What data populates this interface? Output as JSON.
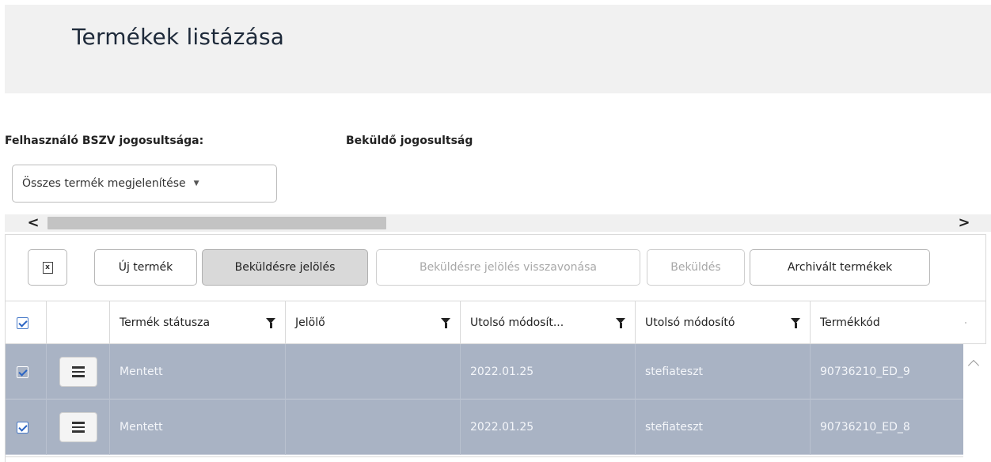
{
  "page": {
    "title": "Termékek listázása"
  },
  "permissions": {
    "label": "Felhasználó BSZV jogosultsága:",
    "value": "Beküldő jogosultság"
  },
  "filter": {
    "selected": "Összes termék megjelenítése"
  },
  "scroll": {
    "left_arrow": "<",
    "right_arrow": ">"
  },
  "toolbar": {
    "export_icon_glyph": "x",
    "new_product": "Új termék",
    "mark_for_submission": "Beküldésre jelölés",
    "revoke_mark": "Beküldésre jelölés visszavonása",
    "submit": "Beküldés",
    "archived": "Archivált termékek"
  },
  "columns": {
    "status": "Termék státusza",
    "marker": "Jelölő",
    "last_modified": "Utolsó módosít...",
    "last_modifier": "Utolsó módosító",
    "product_code": "Termékkód"
  },
  "rows": [
    {
      "checked": true,
      "status": "Mentett",
      "marker": "",
      "last_modified": "2022.01.25",
      "last_modifier": "stefiateszt",
      "product_code": "90736210_ED_9"
    },
    {
      "checked": true,
      "status": "Mentett",
      "marker": "",
      "last_modified": "2022.01.25",
      "last_modifier": "stefiateszt",
      "product_code": "90736210_ED_8"
    }
  ],
  "colors": {
    "selected_row": "#a9b3c4",
    "header_band": "#f1f1f1",
    "checkbox_accent": "#2a64c4"
  },
  "icons": {
    "export": "excel-export-icon",
    "filter": "funnel-icon",
    "row_menu": "hamburger-menu-icon",
    "scroll_up": "chevron-up-icon",
    "dropdown": "caret-down-icon"
  }
}
